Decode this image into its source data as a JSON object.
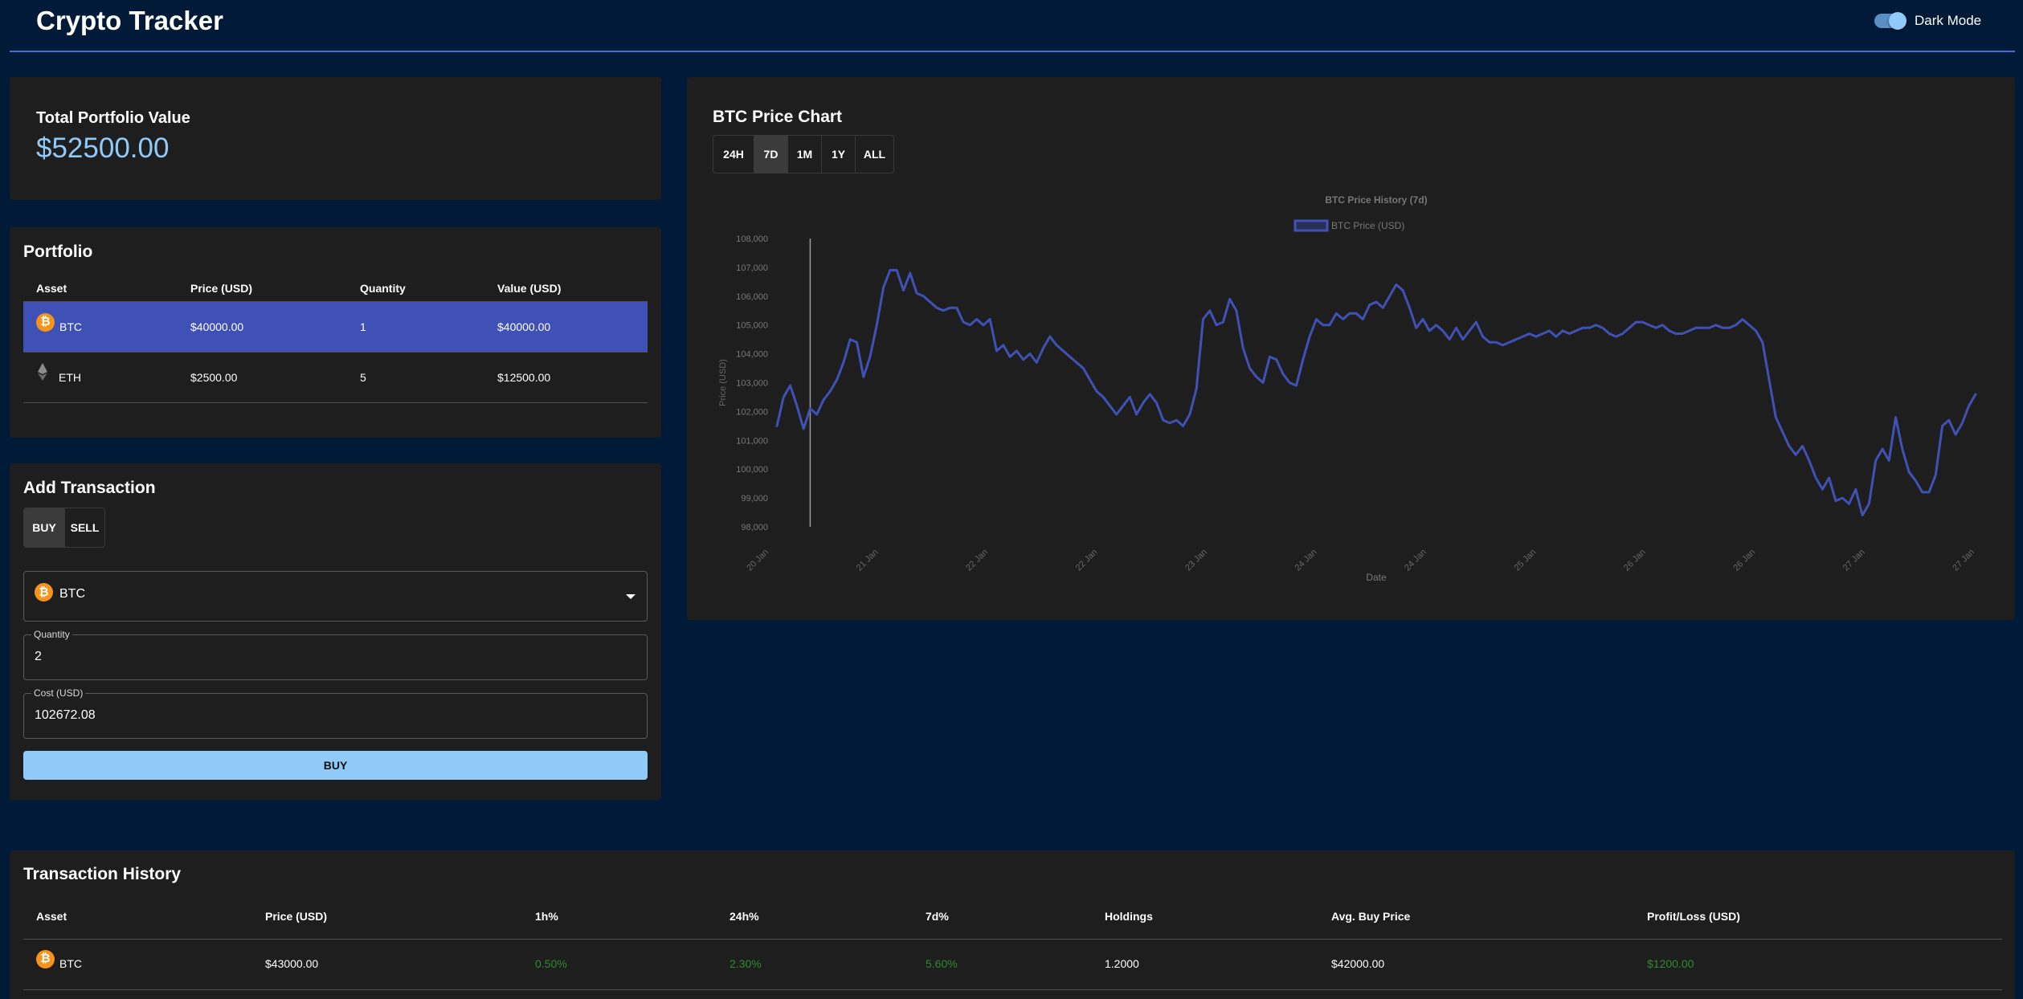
{
  "app": {
    "title": "Crypto Tracker",
    "dark_mode_label": "Dark Mode",
    "dark_mode_on": true
  },
  "total": {
    "label": "Total Portfolio Value",
    "value": "$52500.00"
  },
  "portfolio": {
    "title": "Portfolio",
    "columns": [
      "Asset",
      "Price (USD)",
      "Quantity",
      "Value (USD)"
    ],
    "rows": [
      {
        "asset": "BTC",
        "icon": "bitcoin-icon",
        "price": "$40000.00",
        "quantity": "1",
        "value": "$40000.00",
        "selected": true
      },
      {
        "asset": "ETH",
        "icon": "ethereum-icon",
        "price": "$2500.00",
        "quantity": "5",
        "value": "$12500.00",
        "selected": false
      }
    ]
  },
  "transaction": {
    "title": "Add Transaction",
    "buy_label": "BUY",
    "sell_label": "SELL",
    "active_mode": "BUY",
    "asset_selected": "BTC",
    "quantity_label": "Quantity",
    "quantity_value": "2",
    "cost_label": "Cost (USD)",
    "cost_value": "102672.08",
    "submit_label": "BUY"
  },
  "chart": {
    "title": "BTC Price Chart",
    "ranges": [
      "24H",
      "7D",
      "1M",
      "1Y",
      "ALL"
    ],
    "active_range": "7D",
    "line_color": "#3f51b5"
  },
  "chart_data": {
    "type": "line",
    "title": "BTC Price History (7d)",
    "xlabel": "Date",
    "ylabel": "Price (USD)",
    "ylim": [
      98000,
      108000
    ],
    "yticks": [
      "108,000",
      "107,000",
      "106,000",
      "105,000",
      "104,000",
      "103,000",
      "102,000",
      "101,000",
      "100,000",
      "99,000",
      "98,000"
    ],
    "x_tick_labels": [
      "20 Jan",
      "21 Jan",
      "22 Jan",
      "22 Jan",
      "23 Jan",
      "24 Jan",
      "24 Jan",
      "25 Jan",
      "26 Jan",
      "26 Jan",
      "27 Jan",
      "27 Jan"
    ],
    "legend": "top",
    "grid": false,
    "series": [
      {
        "name": "BTC Price (USD)",
        "values": [
          101500,
          102500,
          102900,
          102200,
          101400,
          102100,
          101900,
          102400,
          102700,
          103100,
          103700,
          104500,
          104400,
          103200,
          103900,
          105000,
          106300,
          106900,
          106900,
          106200,
          106800,
          106100,
          106000,
          105800,
          105600,
          105500,
          105600,
          105600,
          105100,
          105000,
          105200,
          105000,
          105200,
          104100,
          104300,
          103900,
          104100,
          103800,
          104000,
          103700,
          104200,
          104600,
          104300,
          104100,
          103900,
          103700,
          103500,
          103100,
          102700,
          102500,
          102200,
          101900,
          102200,
          102500,
          101900,
          102300,
          102600,
          102300,
          101700,
          101600,
          101700,
          101500,
          101900,
          102800,
          105200,
          105500,
          105000,
          105100,
          105900,
          105500,
          104200,
          103500,
          103200,
          103000,
          103900,
          103800,
          103300,
          103000,
          102900,
          103800,
          104600,
          105200,
          105000,
          105000,
          105400,
          105200,
          105400,
          105400,
          105200,
          105700,
          105800,
          105600,
          106000,
          106400,
          106200,
          105600,
          104900,
          105200,
          104800,
          105000,
          104800,
          104500,
          104900,
          104500,
          104800,
          105100,
          104600,
          104400,
          104400,
          104300,
          104400,
          104500,
          104600,
          104700,
          104600,
          104700,
          104800,
          104600,
          104800,
          104700,
          104800,
          104900,
          104900,
          105000,
          104900,
          104700,
          104600,
          104700,
          104900,
          105100,
          105100,
          105000,
          104900,
          105000,
          104800,
          104700,
          104700,
          104800,
          104900,
          104900,
          104900,
          105000,
          104900,
          104900,
          105000,
          105200,
          105000,
          104800,
          104400,
          103100,
          101800,
          101300,
          100800,
          100500,
          100800,
          100300,
          99700,
          99300,
          99700,
          98900,
          99000,
          98800,
          99300,
          98400,
          98800,
          100300,
          100700,
          100300,
          101800,
          100700,
          99900,
          99600,
          99200,
          99200,
          99800,
          101500,
          101700,
          101200,
          101600,
          102200,
          102600
        ]
      }
    ],
    "cursor_index": 5
  },
  "history": {
    "title": "Transaction History",
    "columns": [
      "Asset",
      "Price (USD)",
      "1h%",
      "24h%",
      "7d%",
      "Holdings",
      "Avg. Buy Price",
      "Profit/Loss (USD)"
    ],
    "rows": [
      {
        "asset": "BTC",
        "icon": "bitcoin-icon",
        "price": "$43000.00",
        "h1": "0.50%",
        "h24": "2.30%",
        "d7": "5.60%",
        "holdings": "1.2000",
        "avg": "$42000.00",
        "pl": "$1200.00"
      }
    ]
  },
  "colors": {
    "background": "#001a38",
    "card": "#1e1e1e",
    "accent": "#90caf9",
    "selected_row": "#3f51b5",
    "positive": "#2e8b2e"
  }
}
